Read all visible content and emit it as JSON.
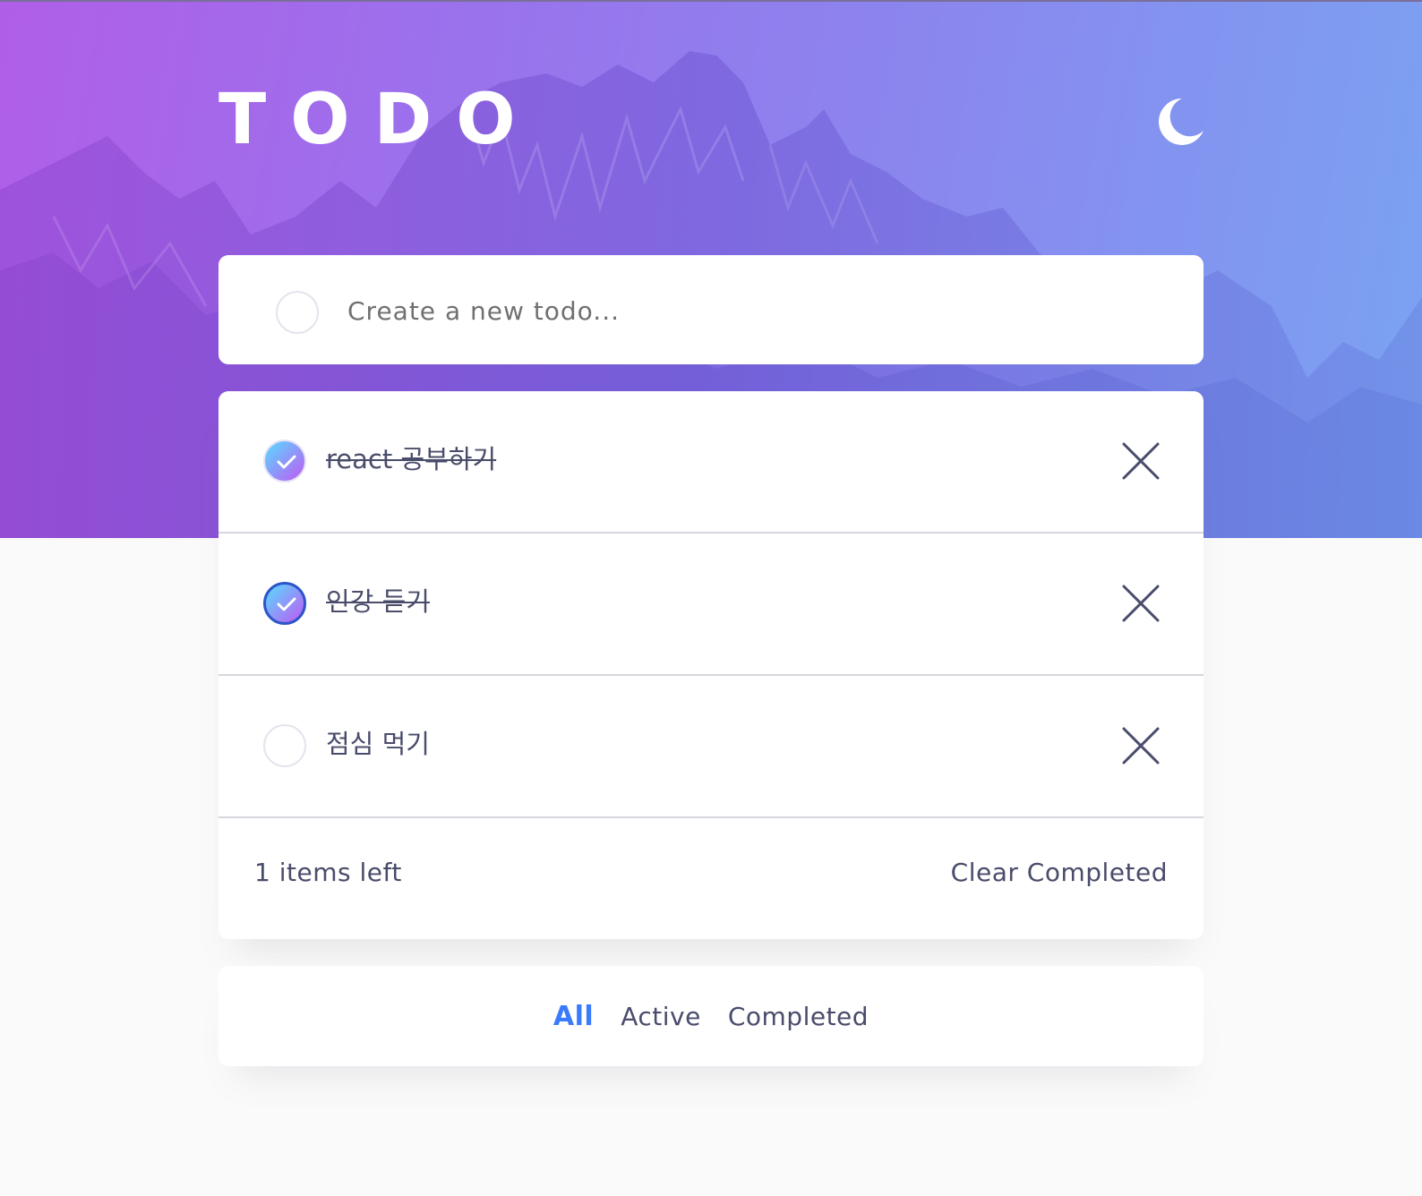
{
  "app": {
    "title": "TODO",
    "theme_toggle_icon": "moon-icon"
  },
  "new_todo": {
    "placeholder": "Create a new todo...",
    "value": ""
  },
  "todos": [
    {
      "text": "react 공부하기",
      "completed": true
    },
    {
      "text": "인강 듣기",
      "completed": true
    },
    {
      "text": "점심 먹기",
      "completed": false
    }
  ],
  "footer": {
    "items_left": "1 items left",
    "clear_label": "Clear Completed"
  },
  "filters": {
    "all": "All",
    "active": "Active",
    "completed": "Completed",
    "selected": "All"
  },
  "colors": {
    "accent": "#3a7bfd",
    "check_gradient_start": "#57ddff",
    "check_gradient_end": "#c058f3",
    "text": "#494c6b",
    "background": "#fafafa"
  }
}
